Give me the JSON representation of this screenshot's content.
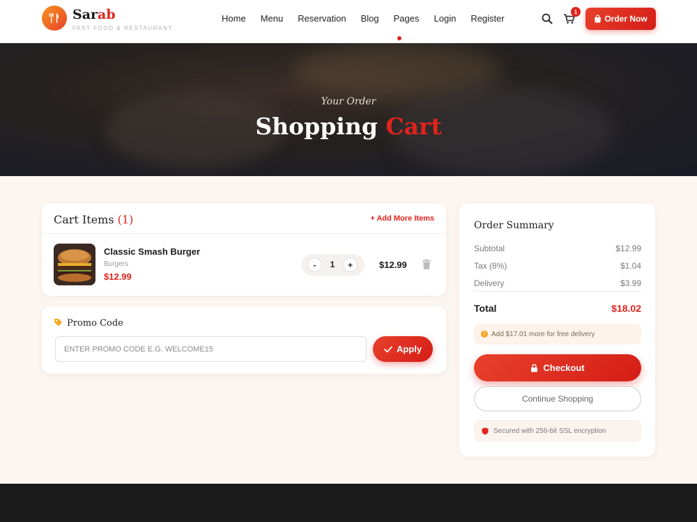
{
  "brand": {
    "name_prefix": "Sar",
    "name_suffix": "ab",
    "tagline": "FAST FOOD & RESTAURANT"
  },
  "nav": {
    "items": [
      "Home",
      "Menu",
      "Reservation",
      "Blog",
      "Pages",
      "Login",
      "Register"
    ],
    "cart_count": "1",
    "order_now_label": "Order Now"
  },
  "hero": {
    "subtitle": "Your Order",
    "title_main": "Shopping",
    "title_accent": "Cart"
  },
  "cart": {
    "title": "Cart Items",
    "count": "(1)",
    "add_more_label": "+ Add More Items",
    "items": [
      {
        "name": "Classic Smash Burger",
        "category": "Burgers",
        "price": "$12.99",
        "quantity": "1",
        "line_total": "$12.99"
      }
    ]
  },
  "promo": {
    "title": "Promo Code",
    "placeholder": "ENTER PROMO CODE E.G. WELCOME15",
    "apply_label": "Apply"
  },
  "summary": {
    "title": "Order Summary",
    "rows": [
      {
        "label": "Subtotal",
        "value": "$12.99"
      },
      {
        "label": "Tax (8%)",
        "value": "$1.04"
      },
      {
        "label": "Delivery",
        "value": "$3.99"
      }
    ],
    "total_label": "Total",
    "total_value": "$18.02",
    "free_delivery_note": "Add $17.01 more for free delivery",
    "checkout_label": "Checkout",
    "continue_label": "Continue Shopping",
    "secure_note": "Secured with 256-bit SSL encryption"
  },
  "colors": {
    "accent": "#e0231c",
    "background": "#fdf5f0",
    "footer": "#1c1b1b"
  }
}
